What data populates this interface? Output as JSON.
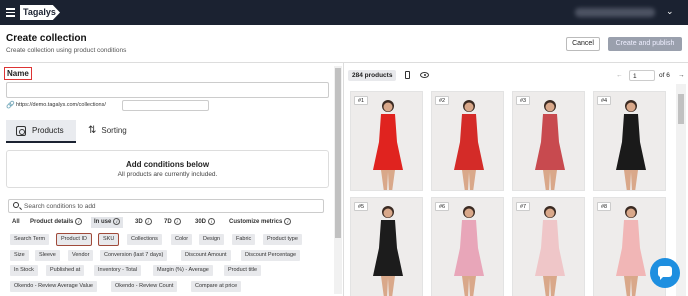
{
  "topbar": {
    "logo_text": "Tagalys",
    "menu_icon": "hamburger-icon",
    "dropdown_icon": "chevron-down-icon",
    "bg_color": "#1b2231"
  },
  "header": {
    "title": "Create collection",
    "subtitle": "Create collection using product conditions",
    "cancel_label": "Cancel",
    "publish_label": "Create and publish"
  },
  "name_section": {
    "label": "Name",
    "value": "",
    "url_prefix": "https://demo.tagalys.com/collections/",
    "url_value": ""
  },
  "tabs": [
    {
      "label": "Products",
      "icon": "product-scan-icon",
      "active": true
    },
    {
      "label": "Sorting",
      "icon": "sort-arrows-icon",
      "active": false
    }
  ],
  "conditions": {
    "title": "Add conditions below",
    "subtitle": "All products are currently included."
  },
  "search": {
    "placeholder": "Search conditions to add"
  },
  "filters": [
    "All",
    "Product details",
    "In use",
    "3D",
    "7D",
    "30D",
    "Customize metrics"
  ],
  "chips": [
    "Search Term",
    "Product ID",
    "SKU",
    "Collections",
    "Color",
    "Design",
    "Fabric",
    "Product type",
    "Size",
    "Sleeve",
    "Vendor",
    "Conversion (last 7 days)",
    "Discount Amount",
    "Discount Percentage",
    "In Stock",
    "Published at",
    "Inventory - Total",
    "Margin (%) - Average",
    "Product title",
    "Okendo - Review Average Value",
    "Okendo - Review Count",
    "Compare at price"
  ],
  "highlighted_chips": [
    "Product ID",
    "SKU"
  ],
  "preview": {
    "product_count": "284 products",
    "page": "1",
    "page_total": "of 6",
    "prev_icon": "arrow-left-icon",
    "next_icon": "arrow-right-icon",
    "products": [
      {
        "num": "#1",
        "color": "#e0231f"
      },
      {
        "num": "#2",
        "color": "#d42b28"
      },
      {
        "num": "#3",
        "color": "#c84a4f"
      },
      {
        "num": "#4",
        "color": "#1a1a1a"
      },
      {
        "num": "#5",
        "color": "#1c1c1c"
      },
      {
        "num": "#6",
        "color": "#e8a6b9"
      },
      {
        "num": "#7",
        "color": "#efc6c8"
      },
      {
        "num": "#8",
        "color": "#f1b6b6"
      }
    ]
  },
  "accent_color": "#1e8fe0"
}
